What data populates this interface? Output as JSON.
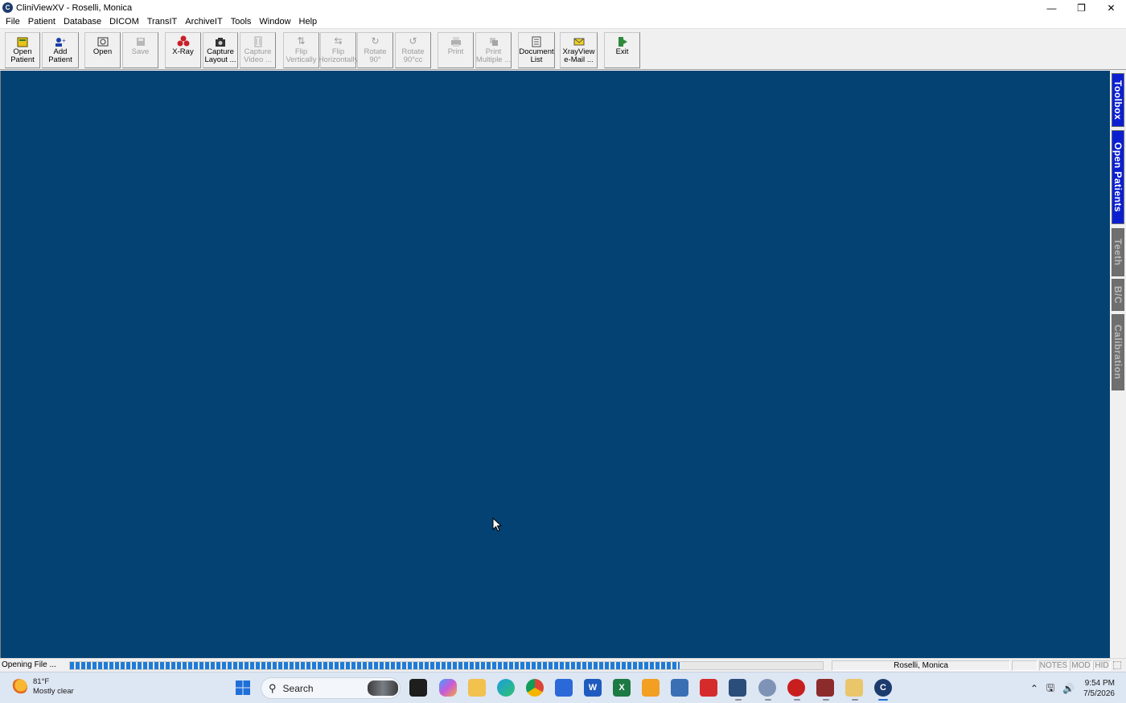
{
  "window": {
    "title": "CliniViewXV - Roselli, Monica",
    "controls": [
      "minimize-icon",
      "restore-icon",
      "close-icon"
    ]
  },
  "menu": [
    "File",
    "Patient",
    "Database",
    "DICOM",
    "TransIT",
    "ArchiveIT",
    "Tools",
    "Window",
    "Help"
  ],
  "toolbar": {
    "buttons": [
      {
        "label": "Open\nPatient",
        "icon": "open-patient-icon",
        "enabled": true
      },
      {
        "label": "Add\nPatient",
        "icon": "add-patient-icon",
        "enabled": true
      },
      {
        "label": "Open",
        "icon": "open-icon",
        "enabled": true
      },
      {
        "label": "Save",
        "icon": "save-icon",
        "enabled": false
      },
      {
        "label": "X-Ray",
        "icon": "xray-icon",
        "enabled": true
      },
      {
        "label": "Capture\nLayout ...",
        "icon": "camera-icon",
        "enabled": true
      },
      {
        "label": "Capture\nVideo ...",
        "icon": "video-icon",
        "enabled": false
      },
      {
        "label": "Flip\nVertically",
        "icon": "flip-vertical-icon",
        "enabled": false
      },
      {
        "label": "Flip\nHorizontally",
        "icon": "flip-horizontal-icon",
        "enabled": false
      },
      {
        "label": "Rotate\n90°",
        "icon": "rotate-cw-icon",
        "enabled": false
      },
      {
        "label": "Rotate\n90°cc",
        "icon": "rotate-ccw-icon",
        "enabled": false
      },
      {
        "label": "Print",
        "icon": "print-icon",
        "enabled": false
      },
      {
        "label": "Print\nMultiple ...",
        "icon": "print-multiple-icon",
        "enabled": false
      },
      {
        "label": "Document\nList",
        "icon": "document-list-icon",
        "enabled": true
      },
      {
        "label": "XrayView\ne-Mail ...",
        "icon": "email-icon",
        "enabled": true
      },
      {
        "label": "Exit",
        "icon": "exit-icon",
        "enabled": true
      }
    ]
  },
  "side_tabs": [
    {
      "label": "Toolbox",
      "active": true
    },
    {
      "label": "Open Patients",
      "active": true
    },
    {
      "label": "Teeth",
      "active": false
    },
    {
      "label": "B/C",
      "active": false
    },
    {
      "label": "Calibration",
      "active": false
    }
  ],
  "status": {
    "text": "Opening File ...",
    "progress": 0.81,
    "patient": "Roselli, Monica",
    "indicators": [
      "NOTES",
      "MOD",
      "HID"
    ]
  },
  "taskbar": {
    "weather_temp": "81°F",
    "weather_desc": "Mostly clear",
    "search_label": "Search",
    "time": "9:54 PM",
    "date": "7/5/2026"
  },
  "colors": {
    "workspace": "#044273",
    "tab_active": "#0b1fd1",
    "tab_inactive": "#6f6f6f",
    "progress": "#1f7bd6"
  }
}
